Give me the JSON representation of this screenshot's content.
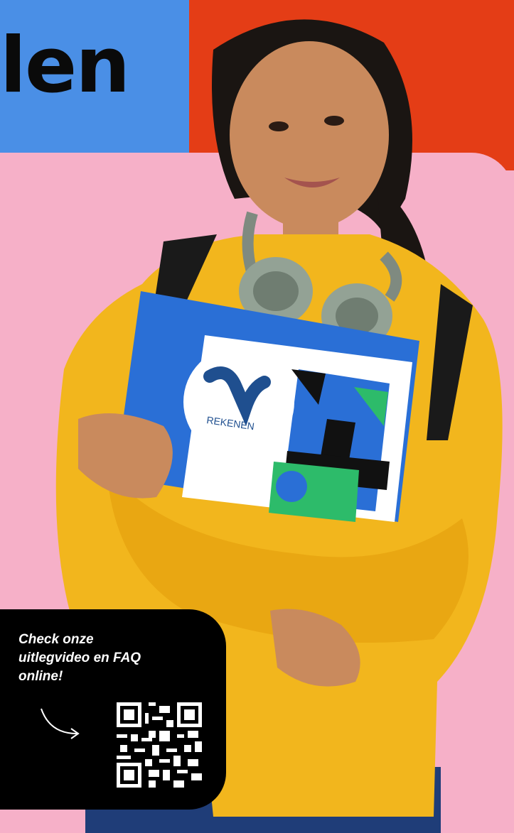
{
  "headline": "len",
  "book": {
    "logo_mark": "NU",
    "title": "REKENEN"
  },
  "cta": {
    "text": "Check onze uitlegvideo en FAQ online!",
    "qr_icon": "qr-code-icon",
    "arrow_icon": "curved-arrow-icon"
  },
  "colors": {
    "blue": "#4a8fe6",
    "red": "#e43d16",
    "pink": "#f6b0c8",
    "yellow": "#f2b61d",
    "book_blue": "#2a6fd6",
    "black": "#000000"
  }
}
